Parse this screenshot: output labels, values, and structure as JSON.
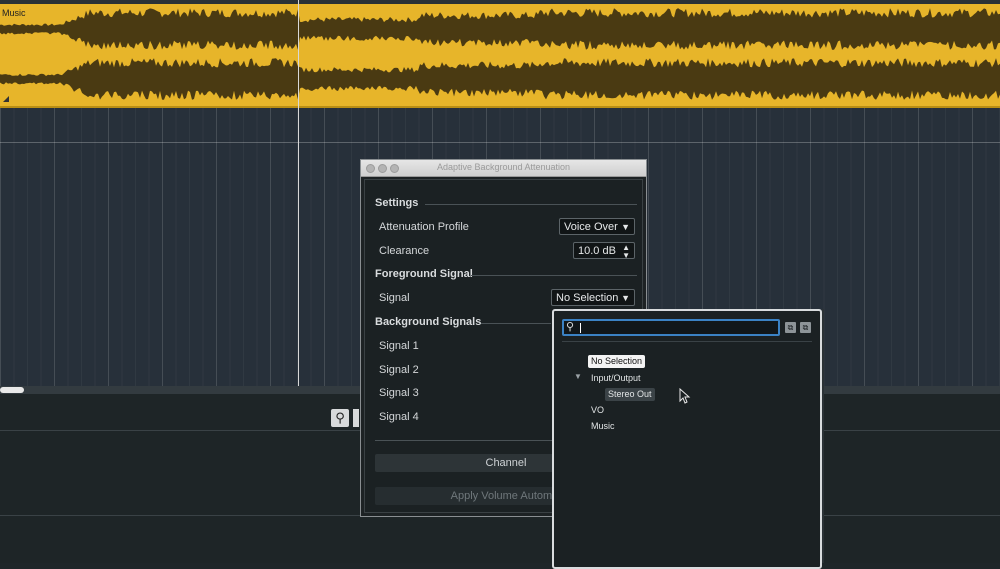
{
  "arrange": {
    "event_name": "Music"
  },
  "dialog": {
    "title": "Adaptive Background Attenuation",
    "settings": {
      "heading": "Settings",
      "attenuation_profile_label": "Attenuation Profile",
      "attenuation_profile_value": "Voice Over",
      "clearance_label": "Clearance",
      "clearance_value": "10.0 dB"
    },
    "foreground": {
      "heading": "Foreground Signal",
      "signal_label": "Signal",
      "signal_value": "No Selection"
    },
    "background": {
      "heading": "Background Signals",
      "signals": [
        "Signal 1",
        "Signal 2",
        "Signal 3",
        "Signal 4"
      ]
    },
    "channel_button": "Channel",
    "apply_button": "Apply Volume Automat"
  },
  "popup": {
    "search_value": "",
    "items": {
      "no_selection": "No Selection",
      "input_output": "Input/Output",
      "stereo_out": "Stereo Out",
      "vo": "VO",
      "music": "Music"
    }
  },
  "colors": {
    "event_fill": "#e7b52a",
    "waveform": "#4a3a12",
    "search_focus": "#3b82c4"
  },
  "icons": {
    "search": "magnifier",
    "expand": "triangle-down",
    "zoom": "magnifier"
  }
}
